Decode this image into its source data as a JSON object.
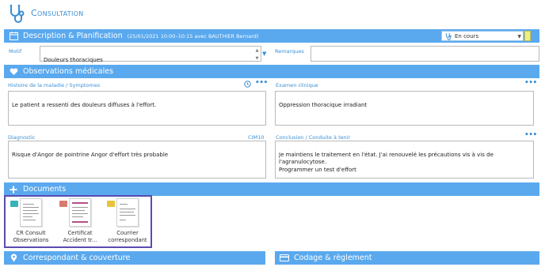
{
  "header": {
    "title": "Consultation",
    "logo_icon": "stethoscope-icon"
  },
  "description": {
    "title": "Description  & Planification",
    "subtitle": "(25/01/2021 10:00–10:15 avec BAUTHIER Bernard)",
    "status": {
      "value": "En cours",
      "icon": "stethoscope-icon"
    },
    "motif_label": "Motif",
    "motif_value": "Douleurs thoraciques",
    "remarques_label": "Remarques",
    "remarques_value": ""
  },
  "observations": {
    "title": "Observations  médicales",
    "histoire_label": "Histoire de la maladie / Symptomes",
    "histoire_value": "Le patient a ressenti des douleurs diffuses à l'effort.",
    "examen_label": "Examen clinique",
    "examen_value": "Oppression thoracique irradiant",
    "diagnostic_label": "Diagnostic",
    "diagnostic_code": "CIM10",
    "diagnostic_value": "Risque d'Angor de pointrine Angor d'effort très probable",
    "conclusion_label": "Conclusion / Conduite à tenir",
    "conclusion_value": "Je maintiens le traitement en l'état. J'ai renouvelé les précautions vis à vis de l'agranulocytose.\nProgrammer un test d'effort",
    "more": "•••"
  },
  "documents": {
    "title": "Documents",
    "items": [
      {
        "label": "CR Consult Observations",
        "tag_color": "#36b3b8"
      },
      {
        "label": "Certificat Accident tr...",
        "tag_color": "#d97a6f"
      },
      {
        "label": "Courrier correspondant",
        "tag_color": "#e8c33a"
      }
    ]
  },
  "bottom": {
    "correspondant_title": "Correspondant  & couverture",
    "codage_title": "Codage & règlement"
  },
  "colors": {
    "accent": "#5aa9ee",
    "label": "#3a8fd6",
    "selection": "#5b4bb0"
  }
}
